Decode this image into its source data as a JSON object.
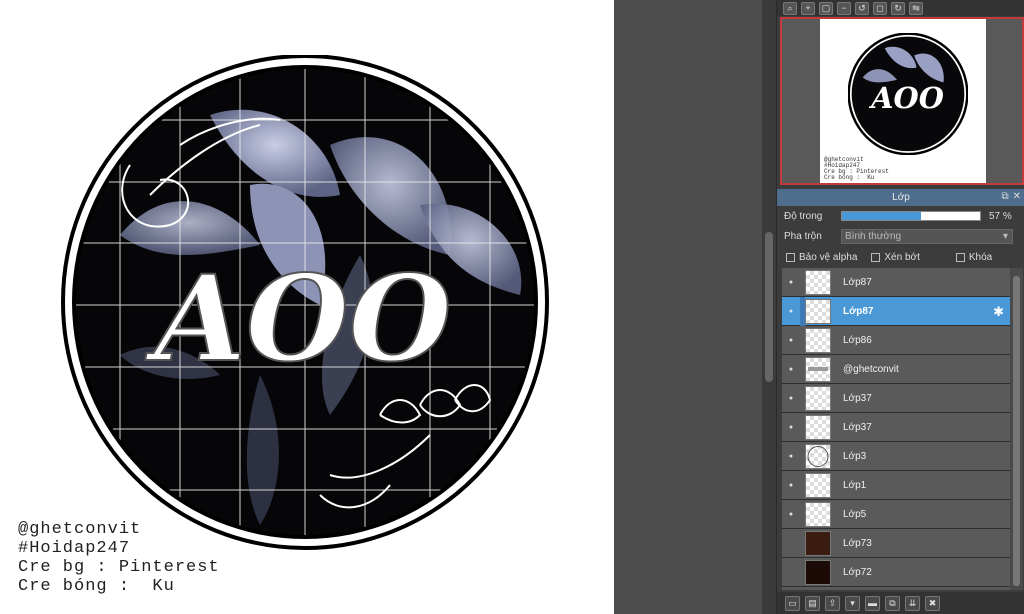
{
  "canvas": {
    "artwork_title": "AOO",
    "credits": [
      "@ghetconvit",
      "#Hoidap247",
      "Cre bg : Pinterest",
      "Cre bóng :  Ku"
    ]
  },
  "nav_toolbar": {
    "icons": [
      "zoom-icon",
      "zoom-in-icon",
      "fit-icon",
      "zoom-out-icon",
      "rotate-left-icon",
      "actual-size-icon",
      "rotate-right-icon",
      "flip-icon"
    ]
  },
  "layers_panel": {
    "title": "Lớp",
    "opacity_label": "Độ trong",
    "opacity_value": "57 %",
    "opacity_fraction": 0.57,
    "blend_label": "Pha trộn",
    "blend_value": "Bình thường",
    "protect_alpha": "Bảo vệ alpha",
    "clipping": "Xén bớt",
    "lock": "Khóa",
    "layers": [
      {
        "name": "Lớp87",
        "visible": true,
        "selected": false,
        "thumb": "empty"
      },
      {
        "name": "Lớp87",
        "visible": true,
        "selected": true,
        "thumb": "empty"
      },
      {
        "name": "Lớp86",
        "visible": true,
        "selected": false,
        "thumb": "empty"
      },
      {
        "name": "@ghetconvit",
        "visible": true,
        "selected": false,
        "thumb": "text"
      },
      {
        "name": "Lớp37",
        "visible": true,
        "selected": false,
        "thumb": "empty"
      },
      {
        "name": "Lớp37",
        "visible": true,
        "selected": false,
        "thumb": "empty"
      },
      {
        "name": "Lớp3",
        "visible": true,
        "selected": false,
        "thumb": "circle"
      },
      {
        "name": "Lớp1",
        "visible": true,
        "selected": false,
        "thumb": "empty"
      },
      {
        "name": "Lớp5",
        "visible": true,
        "selected": false,
        "thumb": "empty"
      },
      {
        "name": "Lớp73",
        "visible": false,
        "selected": false,
        "thumb": "dark"
      },
      {
        "name": "Lớp72",
        "visible": false,
        "selected": false,
        "thumb": "dark2"
      }
    ]
  },
  "colors": {
    "accent": "#4b98d6",
    "panel": "#3c3c3c",
    "navigator_border": "#c43a3a"
  }
}
